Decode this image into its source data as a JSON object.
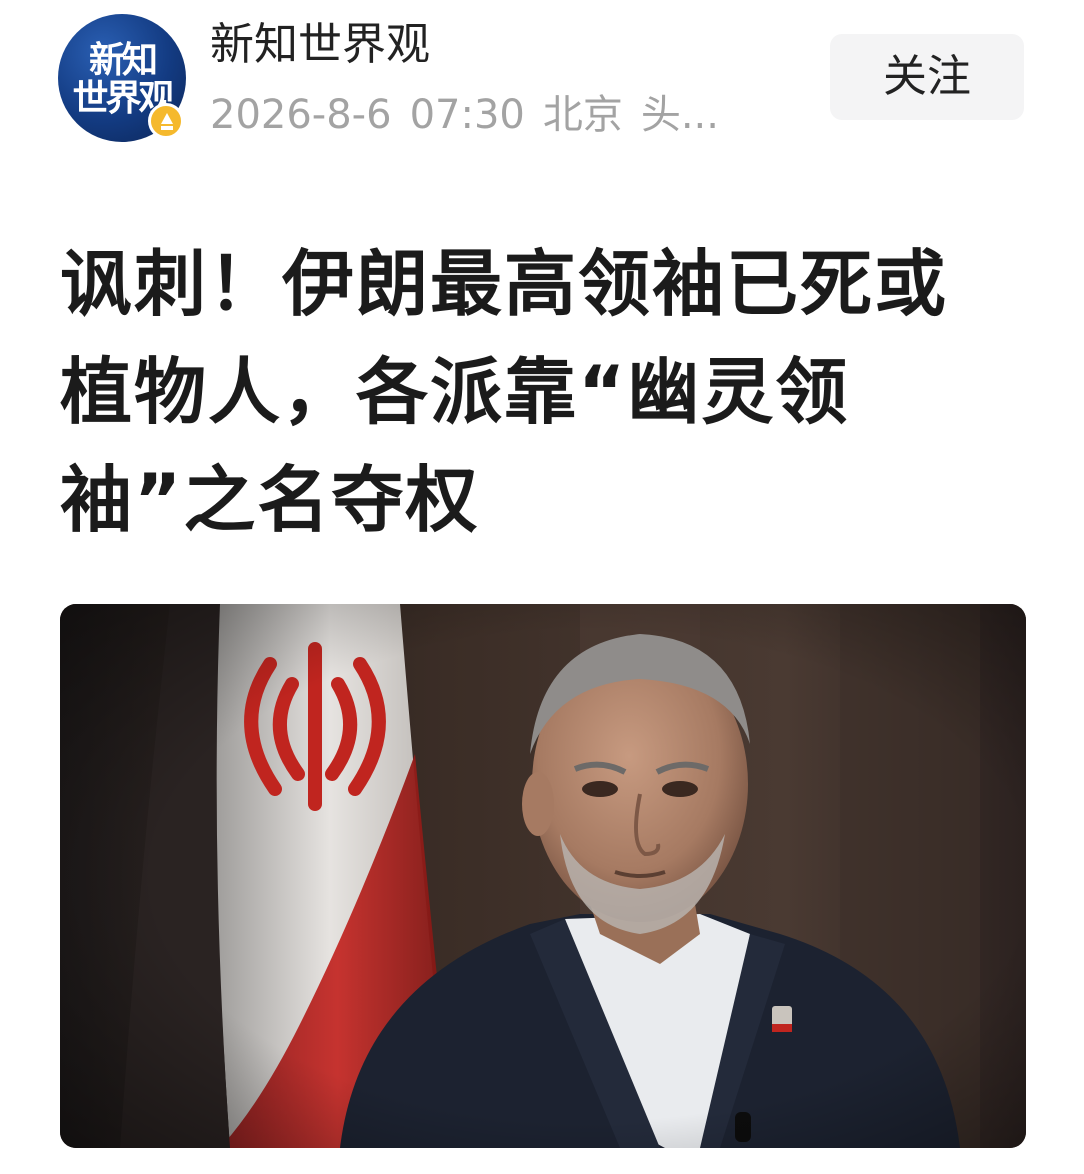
{
  "account": {
    "avatar_text": "新知\n世界观",
    "name": "新知世界观",
    "date": "2026-8-6",
    "time": "07:30",
    "location": "北京",
    "source": "头..."
  },
  "actions": {
    "follow_label": "关注"
  },
  "article": {
    "title": "讽刺！伊朗最高领袖已死或植物人，各派靠“幽灵领袖”之名夺权"
  },
  "icons": {
    "badge": "verified-badge-icon"
  },
  "colors": {
    "avatar_bg": "#133b82",
    "badge": "#f5b92d",
    "title_text": "#1b1b1b",
    "meta_text": "#a3a3a3",
    "follow_bg": "#f4f4f5"
  }
}
